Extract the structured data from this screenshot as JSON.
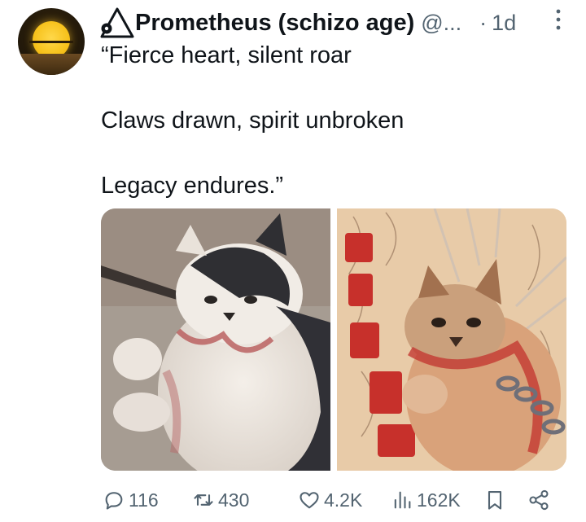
{
  "tweet": {
    "author_name": "Prometheus (schizo age)",
    "author_handle": "@...",
    "separator": "·",
    "timestamp": "1d",
    "text_lines": [
      "“Fierce heart, silent roar",
      "Claws drawn, spirit unbroken",
      "Legacy endures.”"
    ],
    "images": [
      "photo-of-injured-cat",
      "illustration-of-fierce-cat"
    ]
  },
  "actions": {
    "replies": "116",
    "reposts": "430",
    "likes": "4.2K",
    "views": "162K"
  },
  "icons": {
    "reply": "reply-icon",
    "repost": "repost-icon",
    "like": "heart-icon",
    "views": "views-icon",
    "bookmark": "bookmark-icon",
    "share": "share-icon",
    "more": "more-icon",
    "author_logo": "triangle-logo-icon"
  },
  "colors": {
    "text": "#0f1419",
    "muted": "#536471",
    "avatar_sun": "#f7c21c"
  }
}
